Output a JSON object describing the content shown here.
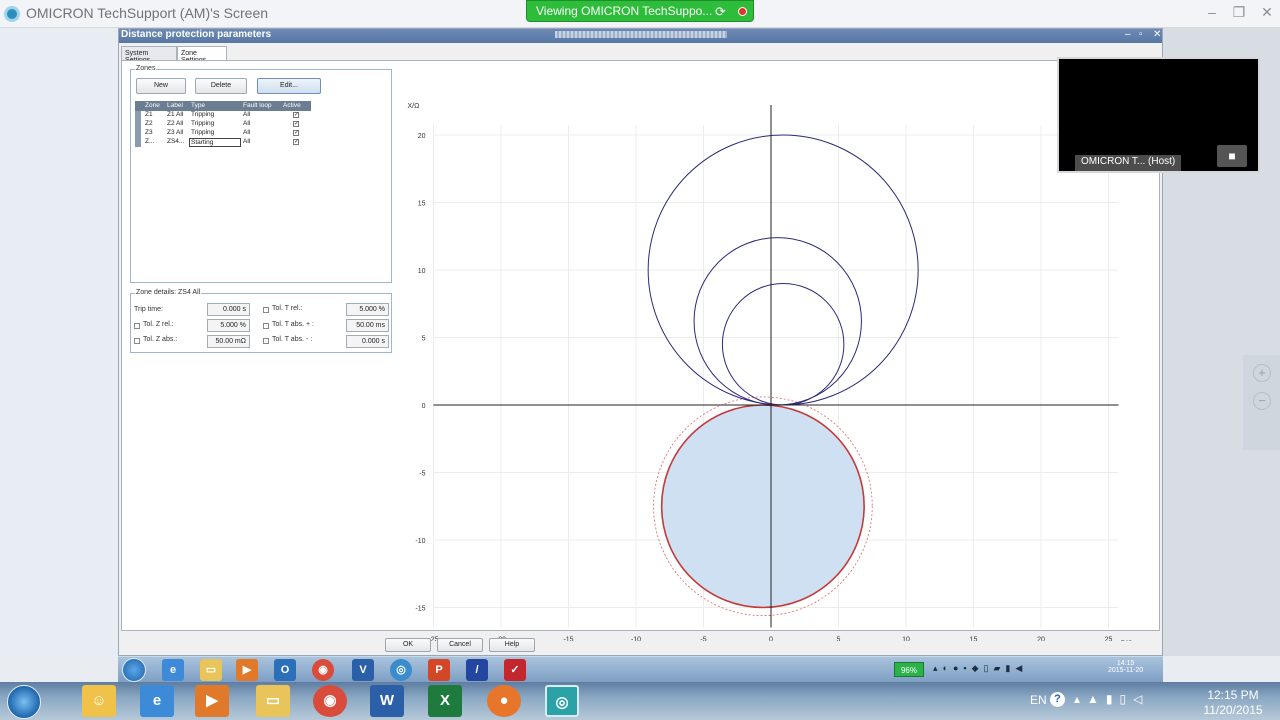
{
  "viewer": {
    "title": "OMICRON TechSupport (AM)'s Screen",
    "banner": "Viewing OMICRON TechSuppo...",
    "video_label": "OMICRON T... (Host)",
    "zoom_in": "+",
    "zoom_out": "−"
  },
  "app": {
    "title": "Distance protection parameters",
    "tabs": [
      "System Settings",
      "Zone Settings"
    ],
    "zones_group": "Zones",
    "buttons": {
      "new": "New",
      "delete": "Delete",
      "edit": "Edit..."
    },
    "table": {
      "headers": [
        "Zone",
        "Label",
        "Type",
        "Fault loop",
        "Active"
      ],
      "rows": [
        [
          "Z1",
          "Z1 All",
          "Tripping",
          "All",
          "✓"
        ],
        [
          "Z2",
          "Z2 All",
          "Tripping",
          "All",
          "✓"
        ],
        [
          "Z3",
          "Z3 All",
          "Tripping",
          "All",
          "✓"
        ],
        [
          "Z...",
          "ZS4...",
          "Starting",
          "All",
          "✓"
        ]
      ]
    },
    "details": {
      "title": "Zone details: ZS4 All",
      "trip_time_label": "Trip time:",
      "trip_time": "0.000 s",
      "tol_z_rel_label": "Tol. Z rel.:",
      "tol_z_rel": "5.000 %",
      "tol_z_abs_label": "Tol. Z abs.:",
      "tol_z_abs": "50.00 mΩ",
      "tol_t_rel_label": "Tol. T rel.:",
      "tol_t_rel": "5.000 %",
      "tol_t_abs_plus_label": "Tol. T abs. + :",
      "tol_t_abs_plus": "50.00 ms",
      "tol_t_abs_minus_label": "Tol. T abs. - :",
      "tol_t_abs_minus": "0.000 s"
    },
    "bottom": {
      "ok": "OK",
      "cancel": "Cancel",
      "help": "Help"
    }
  },
  "chart_data": {
    "type": "scatter",
    "xlabel": "R/Ω",
    "ylabel": "X/Ω",
    "xlim": [
      -25,
      25
    ],
    "ylim": [
      -15,
      20
    ],
    "x_ticks": [
      -25,
      -20,
      -15,
      -10,
      -5,
      0,
      5,
      10,
      15,
      20,
      25
    ],
    "y_ticks": [
      -15,
      -10,
      -5,
      0,
      5,
      10,
      15,
      20
    ],
    "grid": true,
    "circles": [
      {
        "name": "Z1",
        "cx": 0.9,
        "cy": 4.5,
        "r": 4.5,
        "color": "#2a2a7a"
      },
      {
        "name": "Z2",
        "cx": 0.5,
        "cy": 6.2,
        "r": 6.2,
        "color": "#2a2a7a"
      },
      {
        "name": "Z3",
        "cx": 0.9,
        "cy": 10.0,
        "r": 10.0,
        "color": "#2a2a7a"
      },
      {
        "name": "ZS4",
        "cx": -0.6,
        "cy": -7.5,
        "r": 7.5,
        "color": "#c43a3a",
        "fill": "#cfe0f2"
      }
    ],
    "tolerance_circles": [
      {
        "cx": -0.6,
        "cy": -7.5,
        "r": 8.1
      },
      {
        "cx": -0.6,
        "cy": -7.5,
        "r": 6.9
      }
    ]
  },
  "remote_taskbar": {
    "battery": "96%",
    "time": "14:15",
    "date": "2015-11-20"
  },
  "local_taskbar": {
    "lang": "EN",
    "time": "12:15 PM",
    "date": "11/20/2015"
  }
}
